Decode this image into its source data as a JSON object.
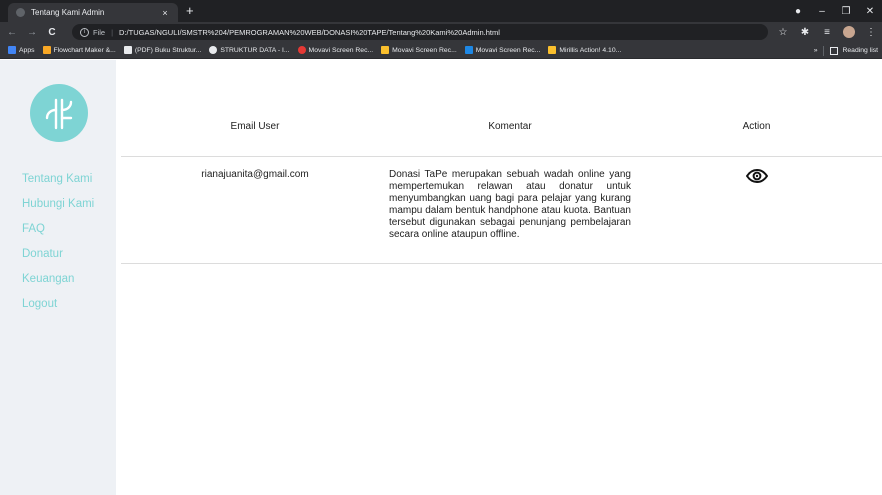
{
  "browser": {
    "tab_title": "Tentang Kami Admin",
    "tab_close": "×",
    "new_tab": "+",
    "scheme": "File",
    "info_glyph": "i",
    "url": "D:/TUGAS/NGULI/SMSTR%204/PEMROGRAMAN%20WEB/DONASI%20TAPE/Tentang%20Kami%20Admin.html",
    "bookmarks": [
      {
        "label": "Apps",
        "color": "#f4b400"
      },
      {
        "label": "Flowchart Maker &...",
        "color": "#f9a825"
      },
      {
        "label": "(PDF) Buku Struktur...",
        "color": "#e8eaed"
      },
      {
        "label": "STRUKTUR DATA - I...",
        "color": "#e8eaed"
      },
      {
        "label": "Movavi Screen Rec...",
        "color": "#e53935"
      },
      {
        "label": "Movavi Screen Rec...",
        "color": "#fbc02d"
      },
      {
        "label": "Movavi Screen Rec...",
        "color": "#1e88e5"
      },
      {
        "label": "Mirillis Action! 4.10...",
        "color": "#fbc02d"
      }
    ],
    "more_bookmarks": "»",
    "reading_list": "Reading list"
  },
  "sidebar": {
    "logo_color": "#7ed4d4",
    "menu": [
      {
        "label": "Tentang Kami"
      },
      {
        "label": "Hubungi Kami"
      },
      {
        "label": "FAQ"
      },
      {
        "label": "Donatur"
      },
      {
        "label": "Keuangan"
      },
      {
        "label": "Logout"
      }
    ]
  },
  "table": {
    "headers": {
      "email": "Email User",
      "comment": "Komentar",
      "action": "Action"
    },
    "rows": [
      {
        "email": "rianajuanita@gmail.com",
        "comment": "Donasi TaPe merupakan sebuah wadah online yang mempertemukan relawan atau donatur untuk menyumbangkan uang bagi para pelajar yang kurang mampu dalam bentuk handphone atau kuota. Bantuan tersebut digunakan sebagai penunjang pembelajaran secara online ataupun offline.",
        "action_icon": "eye-icon"
      }
    ]
  }
}
